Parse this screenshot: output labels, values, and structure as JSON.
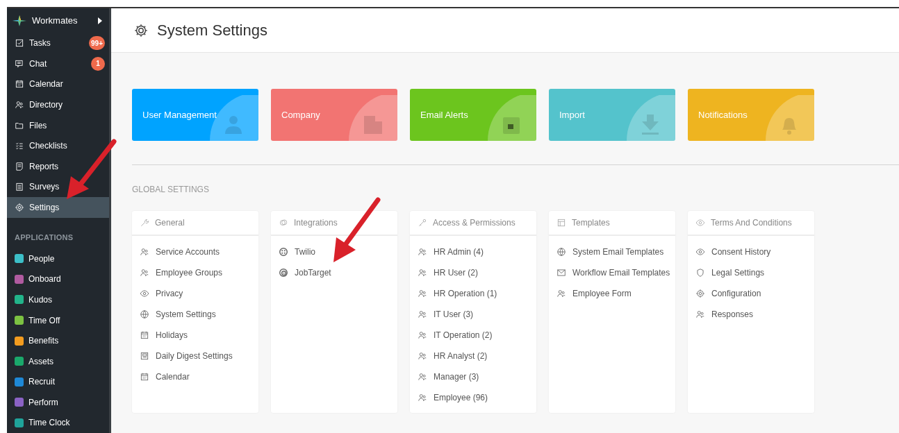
{
  "sidebar": {
    "brand": "Workmates",
    "items": [
      {
        "label": "Tasks",
        "badge": "99+",
        "selected": false
      },
      {
        "label": "Chat",
        "badge": "1",
        "selected": false
      },
      {
        "label": "Calendar",
        "selected": false
      },
      {
        "label": "Directory",
        "selected": false
      },
      {
        "label": "Files",
        "selected": false
      },
      {
        "label": "Checklists",
        "selected": false
      },
      {
        "label": "Reports",
        "selected": false
      },
      {
        "label": "Surveys",
        "selected": false
      },
      {
        "label": "Settings",
        "selected": true
      }
    ],
    "section_title": "APPLICATIONS",
    "apps": [
      {
        "label": "People",
        "color": "#3cbfc8"
      },
      {
        "label": "Onboard",
        "color": "#b05ba0"
      },
      {
        "label": "Kudos",
        "color": "#22b48a"
      },
      {
        "label": "Time Off",
        "color": "#7cc242"
      },
      {
        "label": "Benefits",
        "color": "#f39c1f"
      },
      {
        "label": "Assets",
        "color": "#1aa86b"
      },
      {
        "label": "Recruit",
        "color": "#1e88d6"
      },
      {
        "label": "Perform",
        "color": "#8a62c4"
      },
      {
        "label": "Time Clock",
        "color": "#1fa39a"
      }
    ]
  },
  "page_title": "System Settings",
  "tiles": [
    {
      "label": "User Management",
      "color": "#00a3ff"
    },
    {
      "label": "Company",
      "color": "#f27472"
    },
    {
      "label": "Email Alerts",
      "color": "#6cc51e"
    },
    {
      "label": "Import",
      "color": "#54c3cc"
    },
    {
      "label": "Notifications",
      "color": "#eeb420"
    }
  ],
  "section_title": "GLOBAL SETTINGS",
  "cards": [
    {
      "title": "General",
      "items": [
        "Service Accounts",
        "Employee Groups",
        "Privacy",
        "System Settings",
        "Holidays",
        "Daily Digest Settings",
        "Calendar"
      ]
    },
    {
      "title": "Integrations",
      "items": [
        "Twilio",
        "JobTarget"
      ]
    },
    {
      "title": "Access & Permissions",
      "items": [
        "HR Admin (4)",
        "HR User (2)",
        "HR Operation (1)",
        "IT User (3)",
        "IT Operation (2)",
        "HR Analyst (2)",
        "Manager (3)",
        "Employee (96)"
      ]
    },
    {
      "title": "Templates",
      "items": [
        "System Email Templates",
        "Workflow Email Templates",
        "Employee Form"
      ]
    },
    {
      "title": "Terms And Conditions",
      "items": [
        "Consent History",
        "Legal Settings",
        "Configuration",
        "Responses"
      ]
    }
  ]
}
